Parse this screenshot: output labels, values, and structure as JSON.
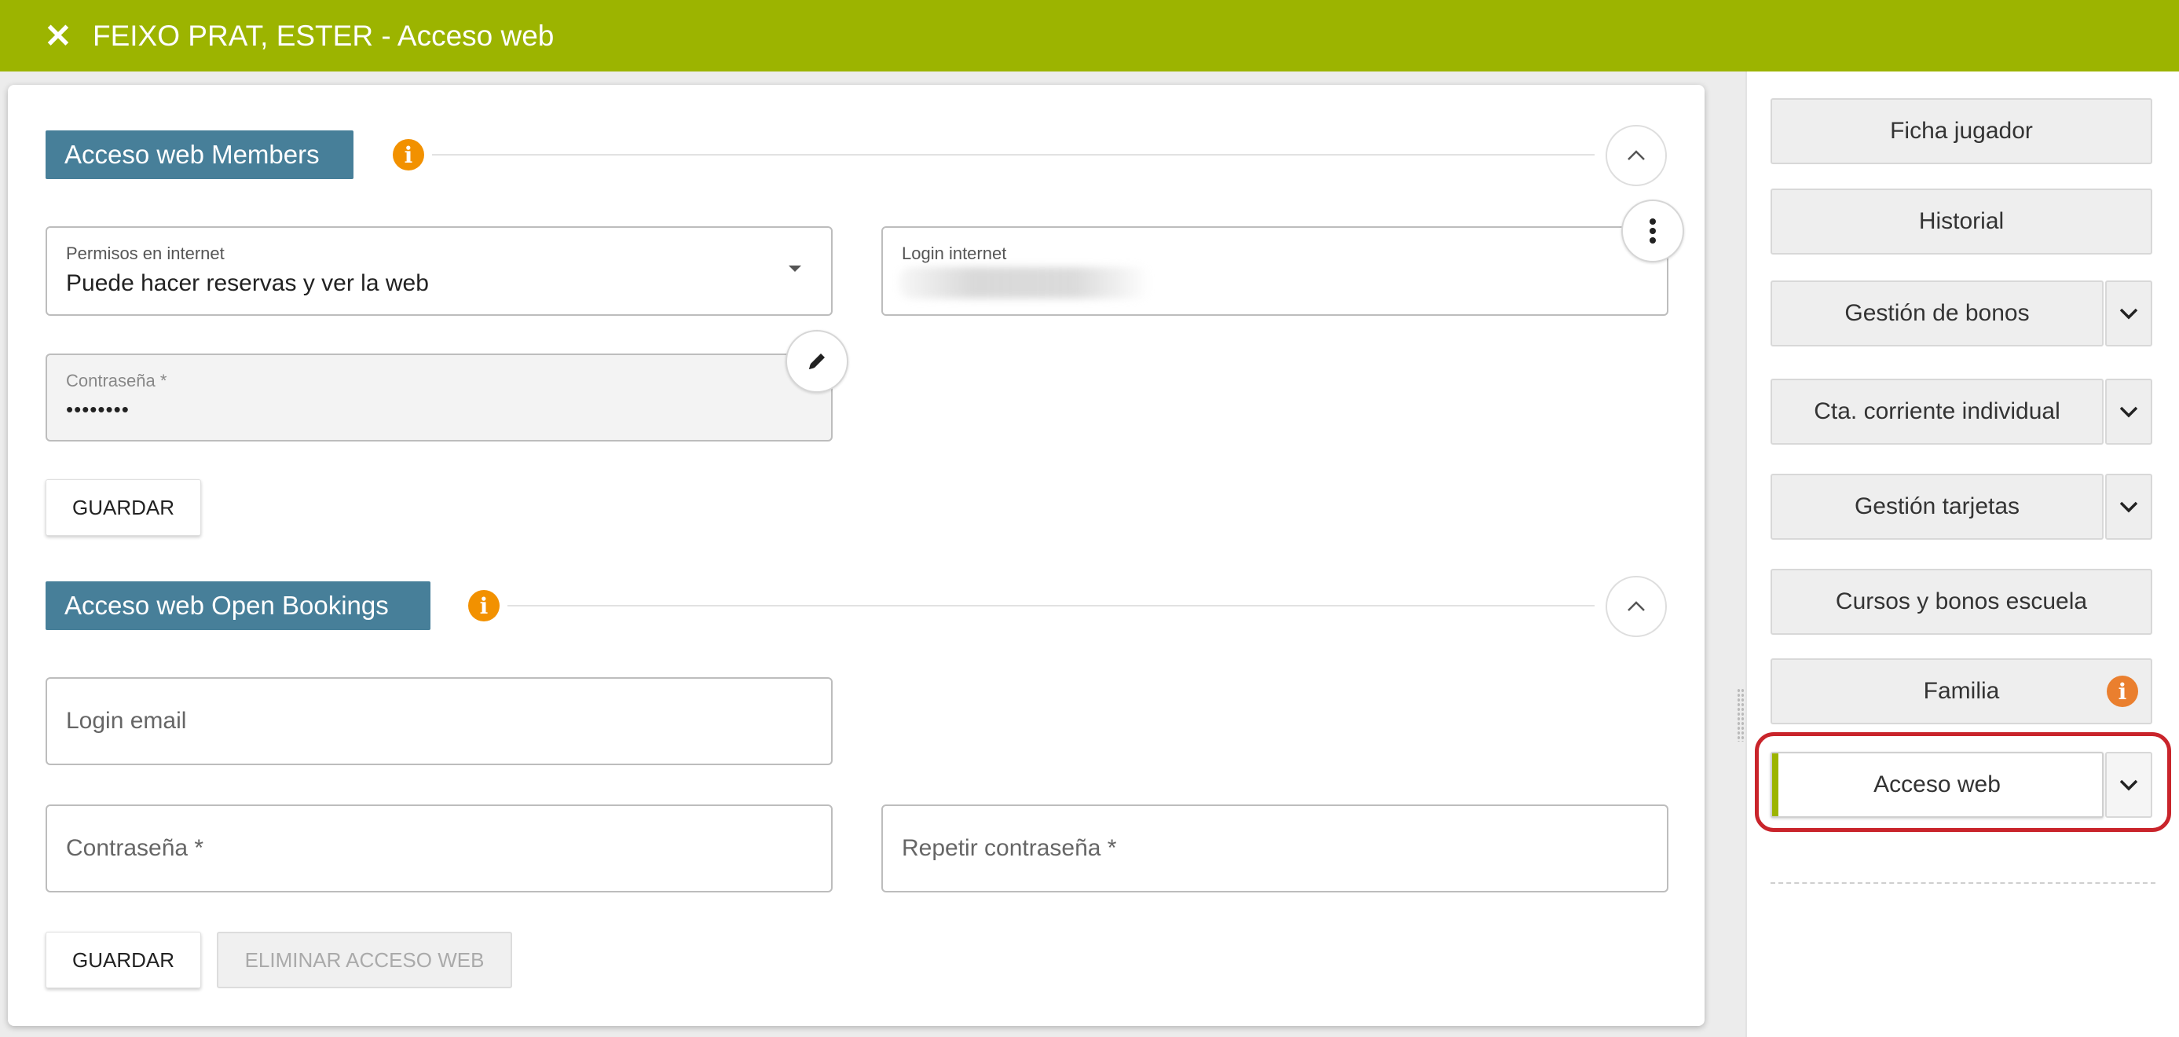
{
  "titlebar": {
    "close_icon": "close-icon",
    "title": "FEIXO PRAT, ESTER - Acceso web"
  },
  "members": {
    "section_title": "Acceso web Members",
    "permisos": {
      "label": "Permisos en internet",
      "value": "Puede hacer reservas y ver la web"
    },
    "login": {
      "label": "Login internet",
      "value": ""
    },
    "password": {
      "label": "Contraseña *",
      "value": "••••••••"
    },
    "save_label": "GUARDAR"
  },
  "open_bookings": {
    "section_title": "Acceso web Open Bookings",
    "login_email_placeholder": "Login email",
    "password_placeholder": "Contraseña *",
    "repeat_password_placeholder": "Repetir contraseña *",
    "save_label": "GUARDAR",
    "delete_label": "ELIMINAR ACCESO WEB"
  },
  "sidebar": {
    "items": [
      {
        "label": "Ficha jugador"
      },
      {
        "label": "Historial"
      },
      {
        "label": "Gestión de bonos"
      },
      {
        "label": "Cta. corriente individual"
      },
      {
        "label": "Gestión tarjetas"
      },
      {
        "label": "Cursos y bonos escuela"
      },
      {
        "label": "Familia"
      },
      {
        "label": "Acceso web"
      }
    ]
  },
  "colors": {
    "header": "#9cb400",
    "section_tag": "#477f99",
    "info": "#f29100",
    "highlight": "#c9242b"
  }
}
